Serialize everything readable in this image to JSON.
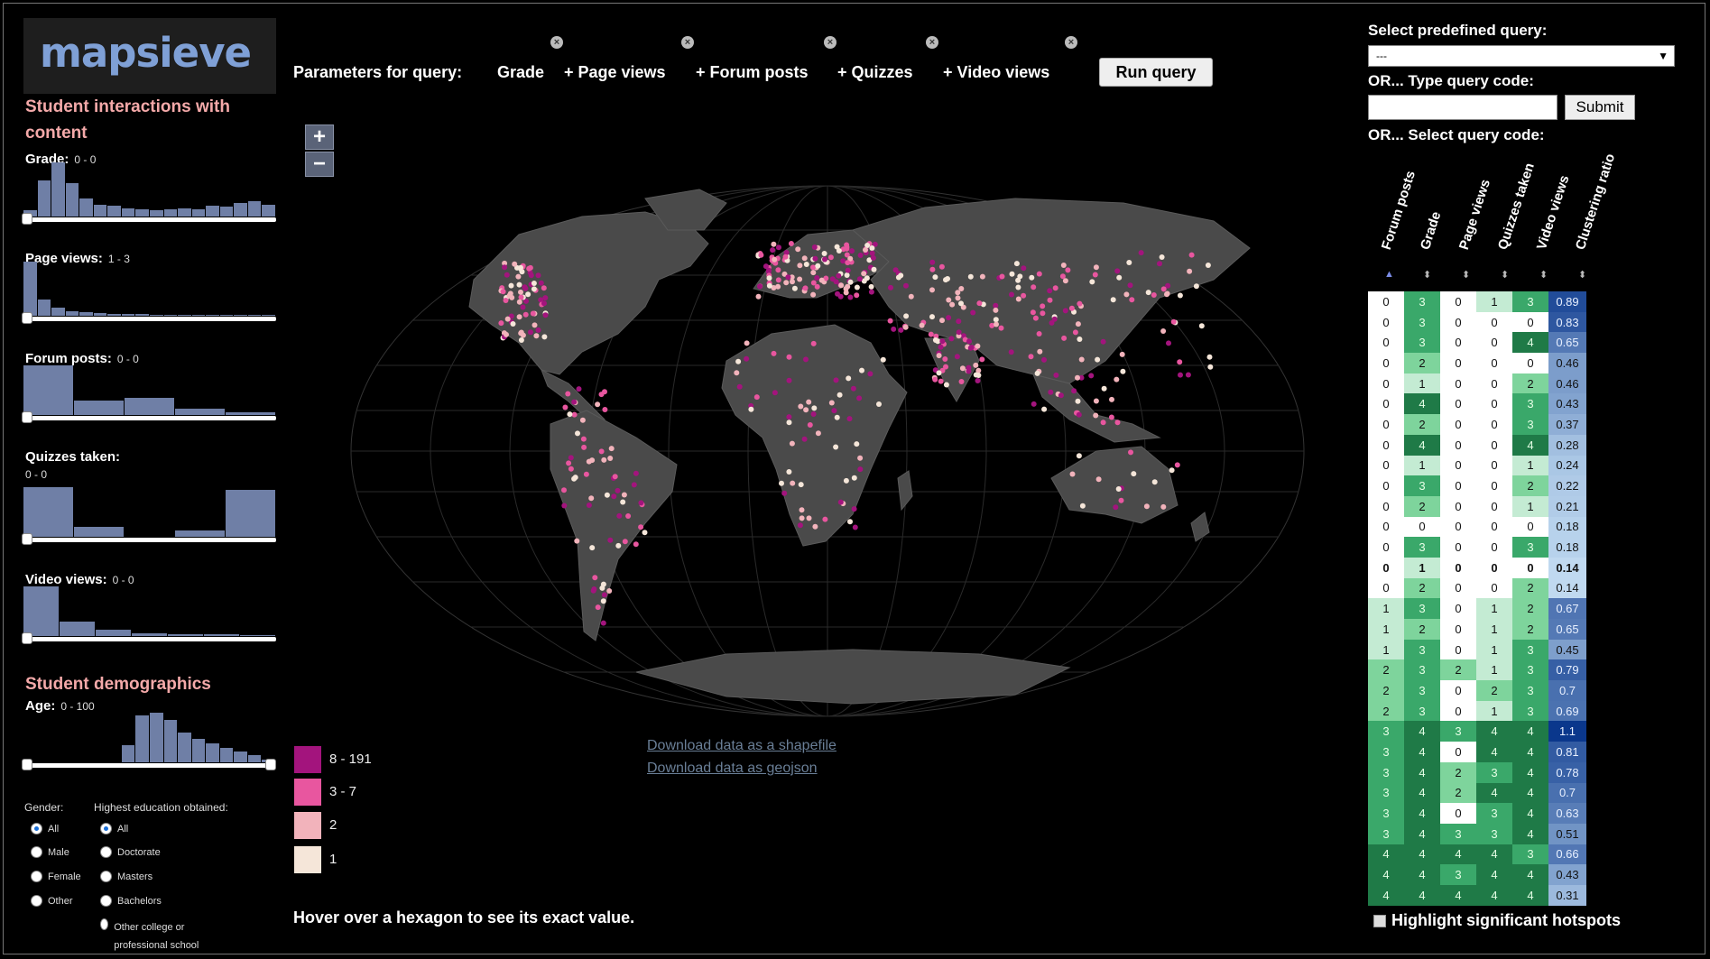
{
  "app": {
    "logo": "mapsieve"
  },
  "sidebar": {
    "interactions_title": "Student interactions with content",
    "demographics_title": "Student demographics",
    "filters": [
      {
        "label": "Grade:",
        "range": "0 - 0",
        "hist": [
          10,
          60,
          90,
          55,
          30,
          20,
          18,
          14,
          12,
          10,
          12,
          14,
          12,
          18,
          16,
          22,
          25,
          20
        ]
      },
      {
        "label": "Page views:",
        "range": "1 - 3",
        "hist": [
          100,
          30,
          15,
          8,
          6,
          5,
          4,
          3,
          3,
          2,
          2,
          2,
          2,
          2,
          2,
          2,
          1,
          1
        ]
      },
      {
        "label": "Forum posts:",
        "range": "0 - 0",
        "hist": [
          100,
          30,
          35,
          12,
          6
        ]
      },
      {
        "label": "Quizzes taken:",
        "range": "0 - 0",
        "hist": [
          100,
          20,
          0,
          12,
          95
        ]
      },
      {
        "label": "Video views:",
        "range": "0 - 0",
        "hist": [
          100,
          30,
          12,
          6,
          4,
          3,
          2
        ]
      },
      {
        "label": "Age:",
        "range": "0 - 100",
        "hist": [
          0,
          0,
          0,
          0,
          0,
          0,
          0,
          35,
          95,
          100,
          85,
          60,
          48,
          38,
          30,
          22,
          14,
          6
        ]
      }
    ],
    "gender": {
      "title": "Gender:",
      "options": [
        "All",
        "Male",
        "Female",
        "Other"
      ],
      "selected": "All"
    },
    "education": {
      "title": "Highest education obtained:",
      "options": [
        "All",
        "Doctorate",
        "Masters",
        "Bachelors",
        "Other college or professional school"
      ],
      "selected": "All"
    }
  },
  "toolbar": {
    "query_label": "Parameters for query:",
    "params": [
      "Grade",
      "+ Page views",
      "+ Forum posts",
      "+ Quizzes",
      "+ Video views"
    ],
    "run_label": "Run query"
  },
  "map": {
    "zoom_in": "+",
    "zoom_out": "−",
    "download_shapefile": "Download data as a shapefile",
    "download_geojson": "Download data as geojson",
    "legend": [
      {
        "label": "8 - 191",
        "color": "#a3147d"
      },
      {
        "label": "3 - 7",
        "color": "#e8569f"
      },
      {
        "label": "2",
        "color": "#f2b3bb"
      },
      {
        "label": "1",
        "color": "#f5e6d9"
      }
    ],
    "hover_note": "Hover over a hexagon to see its exact value.",
    "background_color": "#000000",
    "land_color": "#4a4a4a"
  },
  "right_panel": {
    "predefined_label": "Select predefined query:",
    "predefined_value": "---",
    "type_code_label": "OR... Type query code:",
    "submit_label": "Submit",
    "select_code_label": "OR... Select query code:",
    "columns": [
      "Forum posts",
      "Grade",
      "Page views",
      "Quizzes taken",
      "Video views",
      "Clustering ratio"
    ],
    "sort_up": "▲",
    "sort_both": "⬍",
    "rows": [
      [
        "0",
        "3",
        "0",
        "1",
        "3",
        "0.89"
      ],
      [
        "0",
        "3",
        "0",
        "0",
        "0",
        "0.83"
      ],
      [
        "0",
        "3",
        "0",
        "0",
        "4",
        "0.65"
      ],
      [
        "0",
        "2",
        "0",
        "0",
        "0",
        "0.46"
      ],
      [
        "0",
        "1",
        "0",
        "0",
        "2",
        "0.46"
      ],
      [
        "0",
        "4",
        "0",
        "0",
        "3",
        "0.43"
      ],
      [
        "0",
        "2",
        "0",
        "0",
        "3",
        "0.37"
      ],
      [
        "0",
        "4",
        "0",
        "0",
        "4",
        "0.28"
      ],
      [
        "0",
        "1",
        "0",
        "0",
        "1",
        "0.24"
      ],
      [
        "0",
        "3",
        "0",
        "0",
        "2",
        "0.22"
      ],
      [
        "0",
        "2",
        "0",
        "0",
        "1",
        "0.21"
      ],
      [
        "0",
        "0",
        "0",
        "0",
        "0",
        "0.18"
      ],
      [
        "0",
        "3",
        "0",
        "0",
        "3",
        "0.18"
      ],
      [
        "0",
        "1",
        "0",
        "0",
        "0",
        "0.14"
      ],
      [
        "0",
        "2",
        "0",
        "0",
        "2",
        "0.14"
      ],
      [
        "1",
        "3",
        "0",
        "1",
        "2",
        "0.67"
      ],
      [
        "1",
        "2",
        "0",
        "1",
        "2",
        "0.65"
      ],
      [
        "1",
        "3",
        "0",
        "1",
        "3",
        "0.45"
      ],
      [
        "2",
        "3",
        "2",
        "1",
        "3",
        "0.79"
      ],
      [
        "2",
        "3",
        "0",
        "2",
        "3",
        "0.7"
      ],
      [
        "2",
        "3",
        "0",
        "1",
        "3",
        "0.69"
      ],
      [
        "3",
        "4",
        "3",
        "4",
        "4",
        "1.1"
      ],
      [
        "3",
        "4",
        "0",
        "4",
        "4",
        "0.81"
      ],
      [
        "3",
        "4",
        "2",
        "3",
        "4",
        "0.78"
      ],
      [
        "3",
        "4",
        "2",
        "4",
        "4",
        "0.7"
      ],
      [
        "3",
        "4",
        "0",
        "3",
        "4",
        "0.63"
      ],
      [
        "3",
        "4",
        "3",
        "3",
        "4",
        "0.51"
      ],
      [
        "4",
        "4",
        "4",
        "4",
        "3",
        "0.66"
      ],
      [
        "4",
        "4",
        "3",
        "4",
        "4",
        "0.43"
      ],
      [
        "4",
        "4",
        "4",
        "4",
        "4",
        "0.31"
      ]
    ],
    "bold_row": 13,
    "hotspot_label": "Highlight significant hotspots"
  }
}
